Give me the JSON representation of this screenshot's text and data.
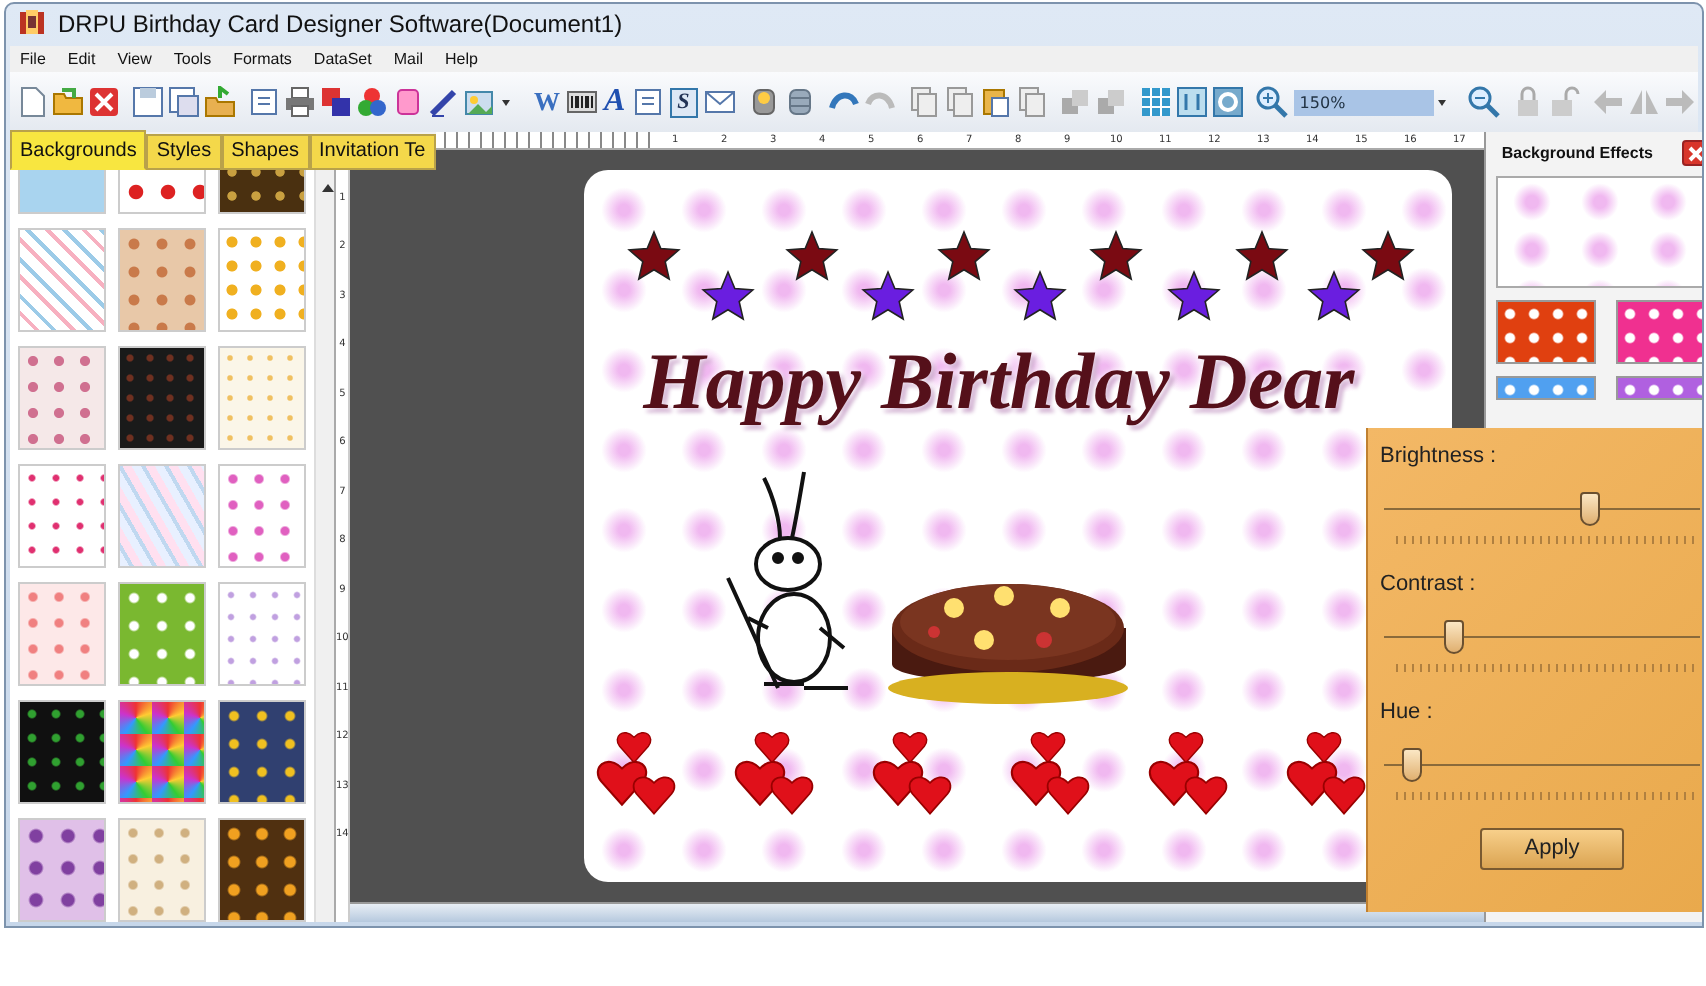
{
  "window": {
    "title": "DRPU Birthday Card Designer Software(Document1)"
  },
  "menu": [
    "File",
    "Edit",
    "View",
    "Tools",
    "Formats",
    "DataSet",
    "Mail",
    "Help"
  ],
  "toolbar": {
    "text_icons": [
      "W",
      "A",
      "S"
    ],
    "zoom_value": "150%"
  },
  "tabs": [
    {
      "label": "Backgrounds",
      "selected": true
    },
    {
      "label": "Styles",
      "selected": false
    },
    {
      "label": "Shapes",
      "selected": false
    },
    {
      "label": "Invitation Te",
      "selected": false
    }
  ],
  "ruler": {
    "horizontal": [
      "1",
      "2",
      "3",
      "4",
      "5",
      "6",
      "7",
      "8",
      "9",
      "10",
      "11",
      "12",
      "13",
      "14",
      "15",
      "16",
      "17"
    ],
    "vertical": [
      "1",
      "2",
      "3",
      "4",
      "5",
      "6",
      "7",
      "8",
      "9",
      "10",
      "11",
      "12",
      "13",
      "14"
    ]
  },
  "card": {
    "heading": "Happy Birthday Dear"
  },
  "background_effects": {
    "title": "Background Effects"
  },
  "adjust_panel": {
    "sliders": [
      {
        "label": "Brightness :",
        "level": 0.65
      },
      {
        "label": "Contrast :",
        "level": 0.22
      },
      {
        "label": "Hue :",
        "level": 0.09
      }
    ],
    "button": "Apply"
  }
}
